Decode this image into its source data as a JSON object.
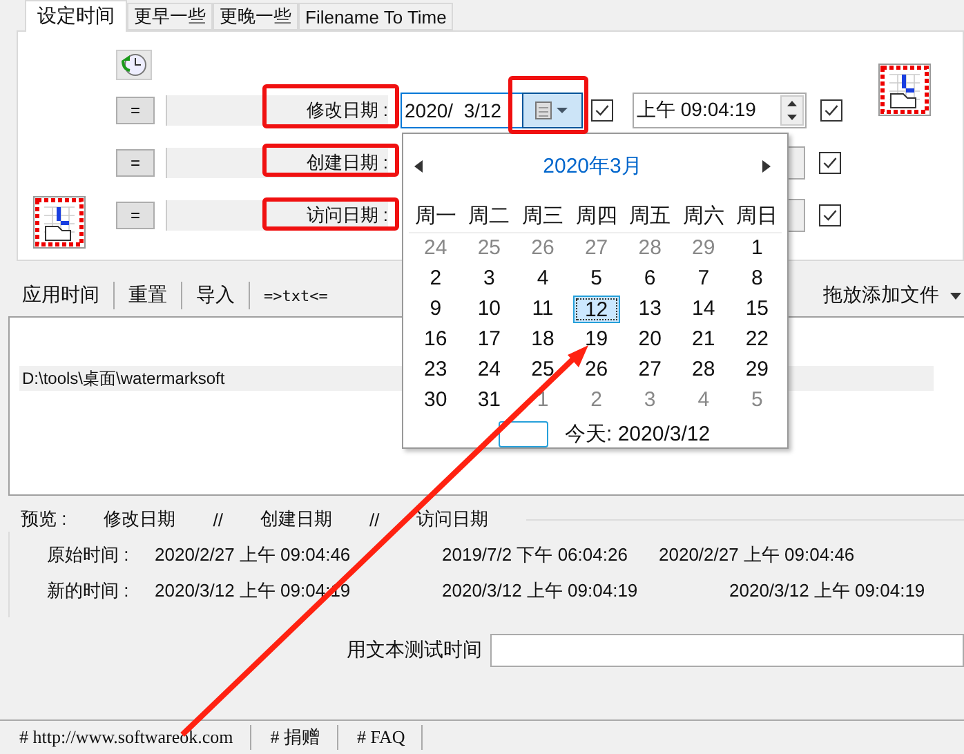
{
  "tabs": [
    {
      "label": "设定时间",
      "selected": true
    },
    {
      "label": "更早一些",
      "selected": false
    },
    {
      "label": "更晚一些",
      "selected": false
    },
    {
      "label": "Filename To Time",
      "selected": false
    }
  ],
  "equals_label": [
    "=",
    "=",
    "="
  ],
  "date_rows": [
    {
      "label": "修改日期 :",
      "date": "2020/  3/12",
      "date_checked": true,
      "time": "上午 09:04:19",
      "time_checked": true
    },
    {
      "label": "创建日期 :",
      "time_checked": true
    },
    {
      "label": "访问日期 :",
      "time_checked": true
    }
  ],
  "toolbar": {
    "buttons": [
      "应用时间",
      "重置",
      "导入",
      "=>txt<="
    ],
    "drop_menu": "拖放添加文件"
  },
  "files": [
    "D:\\tools\\桌面\\watermarksoft"
  ],
  "preview": {
    "title": [
      "预览 :",
      "修改日期",
      "//",
      "创建日期",
      "//",
      "访问日期"
    ],
    "rows": [
      {
        "label": "原始时间 :",
        "values": [
          "2020/2/27 上午 09:04:46",
          "2019/7/2 下午 06:04:26",
          "2020/2/27 上午 09:04:46"
        ]
      },
      {
        "label": "新的时间 :",
        "values": [
          "2020/3/12 上午 09:04:19",
          "2020/3/12 上午 09:04:19",
          "2020/3/12 上午 09:04:19"
        ]
      }
    ]
  },
  "test": {
    "label": "用文本测试时间"
  },
  "status_bar": [
    "# http://www.softwareok.com",
    "# 捐赠",
    "# FAQ"
  ],
  "calendar": {
    "month": "2020年3月",
    "weekdays": [
      "周一",
      "周二",
      "周三",
      "周四",
      "周五",
      "周六",
      "周日"
    ],
    "weeks": [
      [
        {
          "day": "24",
          "other_month": true,
          "selected": false
        },
        {
          "day": "25",
          "other_month": true,
          "selected": false
        },
        {
          "day": "26",
          "other_month": true,
          "selected": false
        },
        {
          "day": "27",
          "other_month": true,
          "selected": false
        },
        {
          "day": "28",
          "other_month": true,
          "selected": false
        },
        {
          "day": "29",
          "other_month": true,
          "selected": false
        },
        {
          "day": "1",
          "other_month": false,
          "selected": false
        }
      ],
      [
        {
          "day": "2",
          "other_month": false,
          "selected": false
        },
        {
          "day": "3",
          "other_month": false,
          "selected": false
        },
        {
          "day": "4",
          "other_month": false,
          "selected": false
        },
        {
          "day": "5",
          "other_month": false,
          "selected": false
        },
        {
          "day": "6",
          "other_month": false,
          "selected": false
        },
        {
          "day": "7",
          "other_month": false,
          "selected": false
        },
        {
          "day": "8",
          "other_month": false,
          "selected": false
        }
      ],
      [
        {
          "day": "9",
          "other_month": false,
          "selected": false
        },
        {
          "day": "10",
          "other_month": false,
          "selected": false
        },
        {
          "day": "11",
          "other_month": false,
          "selected": false
        },
        {
          "day": "12",
          "other_month": false,
          "selected": true
        },
        {
          "day": "13",
          "other_month": false,
          "selected": false
        },
        {
          "day": "14",
          "other_month": false,
          "selected": false
        },
        {
          "day": "15",
          "other_month": false,
          "selected": false
        }
      ],
      [
        {
          "day": "16",
          "other_month": false,
          "selected": false
        },
        {
          "day": "17",
          "other_month": false,
          "selected": false
        },
        {
          "day": "18",
          "other_month": false,
          "selected": false
        },
        {
          "day": "19",
          "other_month": false,
          "selected": false
        },
        {
          "day": "20",
          "other_month": false,
          "selected": false
        },
        {
          "day": "21",
          "other_month": false,
          "selected": false
        },
        {
          "day": "22",
          "other_month": false,
          "selected": false
        }
      ],
      [
        {
          "day": "23",
          "other_month": false,
          "selected": false
        },
        {
          "day": "24",
          "other_month": false,
          "selected": false
        },
        {
          "day": "25",
          "other_month": false,
          "selected": false
        },
        {
          "day": "26",
          "other_month": false,
          "selected": false
        },
        {
          "day": "27",
          "other_month": false,
          "selected": false
        },
        {
          "day": "28",
          "other_month": false,
          "selected": false
        },
        {
          "day": "29",
          "other_month": false,
          "selected": false
        }
      ],
      [
        {
          "day": "30",
          "other_month": false,
          "selected": false
        },
        {
          "day": "31",
          "other_month": false,
          "selected": false
        },
        {
          "day": "1",
          "other_month": true,
          "selected": false
        },
        {
          "day": "2",
          "other_month": true,
          "selected": false
        },
        {
          "day": "3",
          "other_month": true,
          "selected": false
        },
        {
          "day": "4",
          "other_month": true,
          "selected": false
        },
        {
          "day": "5",
          "other_month": true,
          "selected": false
        }
      ]
    ],
    "today": "今天: 2020/3/12"
  }
}
